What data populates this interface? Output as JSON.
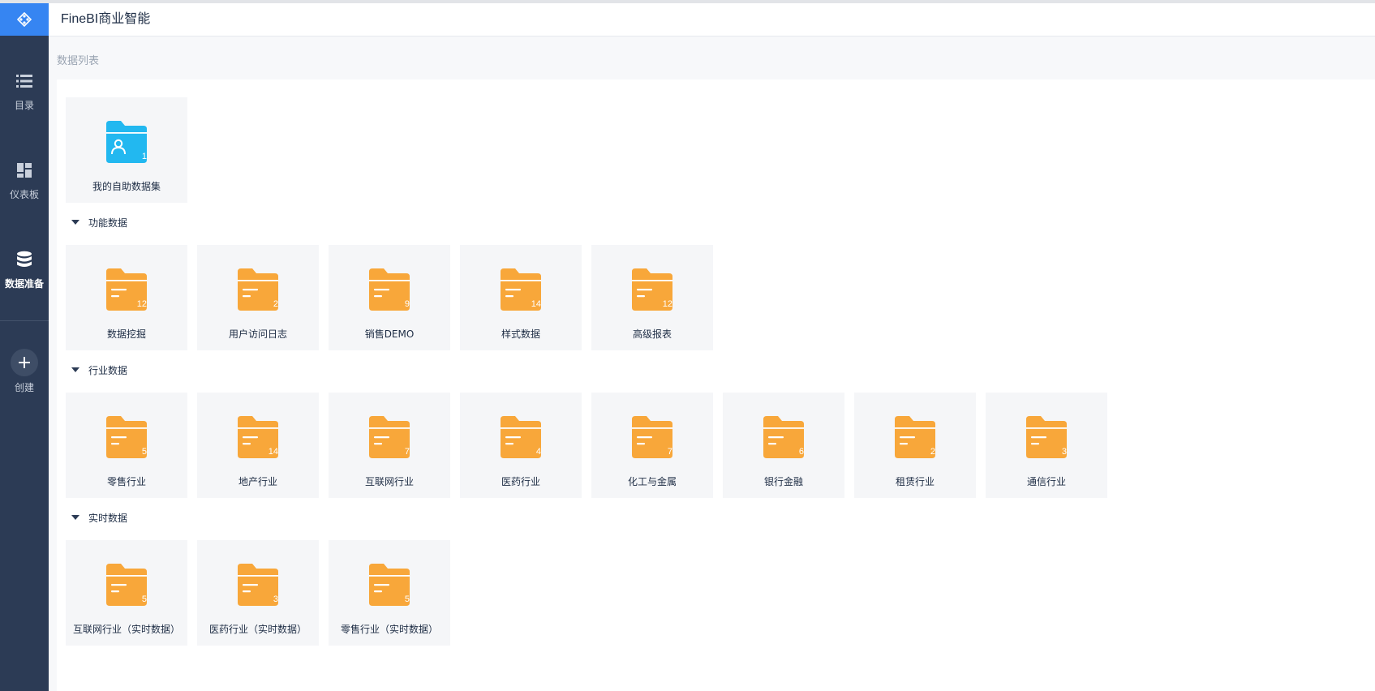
{
  "app": {
    "title": "FineBI商业智能",
    "logo_icon": "logo-icon"
  },
  "sidebar": {
    "items": [
      {
        "label": "目录",
        "icon": "list-icon",
        "active": false
      },
      {
        "label": "仪表板",
        "icon": "dashboard-icon",
        "active": false
      },
      {
        "label": "数据准备",
        "icon": "database-icon",
        "active": true
      },
      {
        "label": "创建",
        "icon": "plus-icon",
        "active": false
      }
    ]
  },
  "page": {
    "title": "数据列表"
  },
  "colors": {
    "sidebar_bg": "#2c3b55",
    "logo_bg": "#3685f2",
    "folder_orange": "#f8a73a",
    "folder_blue": "#22b8f0",
    "tile_bg": "#f5f6f8"
  },
  "my_dataset": {
    "label": "我的自助数据集",
    "count": "1",
    "icon": "user-folder-icon"
  },
  "groups": [
    {
      "name": "功能数据",
      "folders": [
        {
          "label": "数据挖掘",
          "count": "12"
        },
        {
          "label": "用户访问日志",
          "count": "2"
        },
        {
          "label": "销售DEMO",
          "count": "9"
        },
        {
          "label": "样式数据",
          "count": "14"
        },
        {
          "label": "高级报表",
          "count": "12"
        }
      ]
    },
    {
      "name": "行业数据",
      "folders": [
        {
          "label": "零售行业",
          "count": "5"
        },
        {
          "label": "地产行业",
          "count": "14"
        },
        {
          "label": "互联网行业",
          "count": "7"
        },
        {
          "label": "医药行业",
          "count": "4"
        },
        {
          "label": "化工与金属",
          "count": "7"
        },
        {
          "label": "银行金融",
          "count": "6"
        },
        {
          "label": "租赁行业",
          "count": "2"
        },
        {
          "label": "通信行业",
          "count": "3"
        }
      ]
    },
    {
      "name": "实时数据",
      "folders": [
        {
          "label": "互联网行业（实时数据）",
          "count": "5"
        },
        {
          "label": "医药行业（实时数据）",
          "count": "3"
        },
        {
          "label": "零售行业（实时数据）",
          "count": "5"
        }
      ]
    }
  ]
}
